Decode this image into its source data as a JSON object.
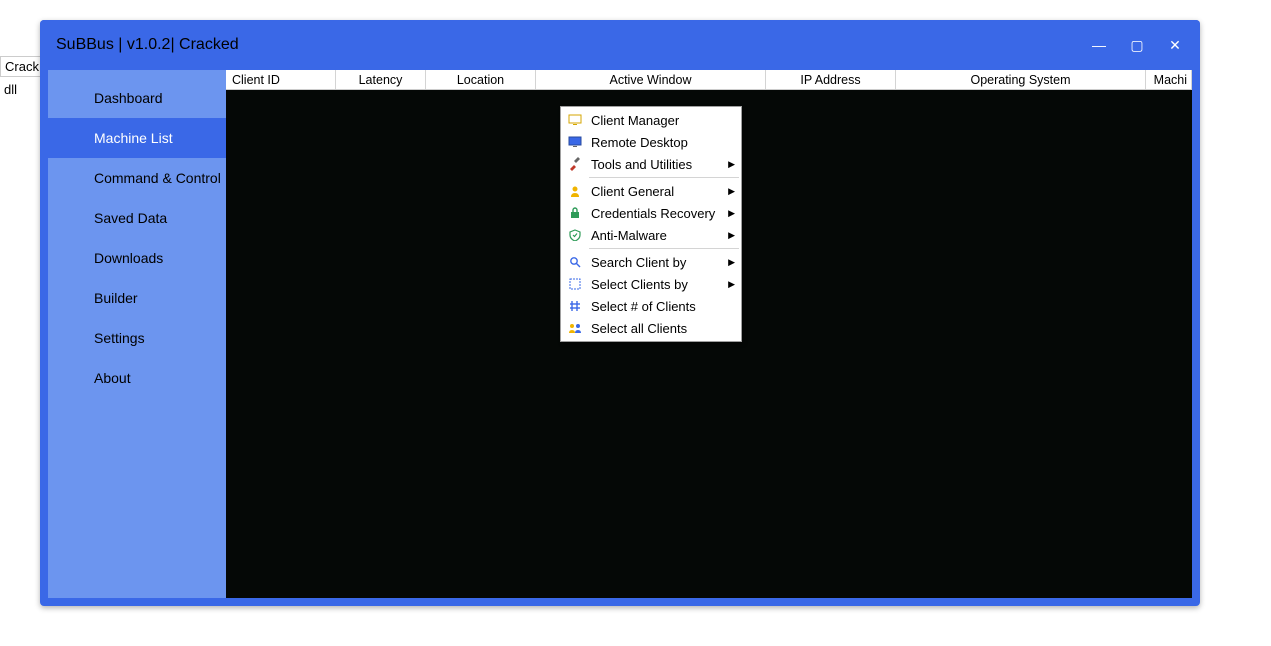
{
  "bg_tags": [
    "Crack",
    "dll"
  ],
  "window": {
    "title": "SuBBus | v1.0.2| Cracked",
    "controls": {
      "min": "—",
      "max": "▢",
      "close": "✕"
    }
  },
  "sidebar": {
    "items": [
      {
        "label": "Dashboard",
        "active": false
      },
      {
        "label": "Machine List",
        "active": true
      },
      {
        "label": "Command & Control",
        "active": false
      },
      {
        "label": "Saved Data",
        "active": false
      },
      {
        "label": "Downloads",
        "active": false
      },
      {
        "label": "Builder",
        "active": false
      },
      {
        "label": "Settings",
        "active": false
      },
      {
        "label": "About",
        "active": false
      }
    ]
  },
  "columns": [
    "Client ID",
    "Latency",
    "Location",
    "Active Window",
    "IP Address",
    "Operating System",
    "Machi"
  ],
  "context_menu": {
    "groups": [
      [
        {
          "icon": "monitor",
          "label": "Client Manager",
          "sub": false
        },
        {
          "icon": "desktop",
          "label": "Remote Desktop",
          "sub": false
        },
        {
          "icon": "tools",
          "label": "Tools and Utilities",
          "sub": true
        }
      ],
      [
        {
          "icon": "user",
          "label": "Client General",
          "sub": true
        },
        {
          "icon": "lock",
          "label": "Credentials Recovery",
          "sub": true
        },
        {
          "icon": "shield",
          "label": "Anti-Malware",
          "sub": true
        }
      ],
      [
        {
          "icon": "search",
          "label": "Search Client by",
          "sub": true
        },
        {
          "icon": "select",
          "label": "Select Clients by",
          "sub": true
        },
        {
          "icon": "hash",
          "label": "Select # of Clients",
          "sub": false
        },
        {
          "icon": "group",
          "label": "Select all Clients",
          "sub": false
        }
      ]
    ]
  }
}
